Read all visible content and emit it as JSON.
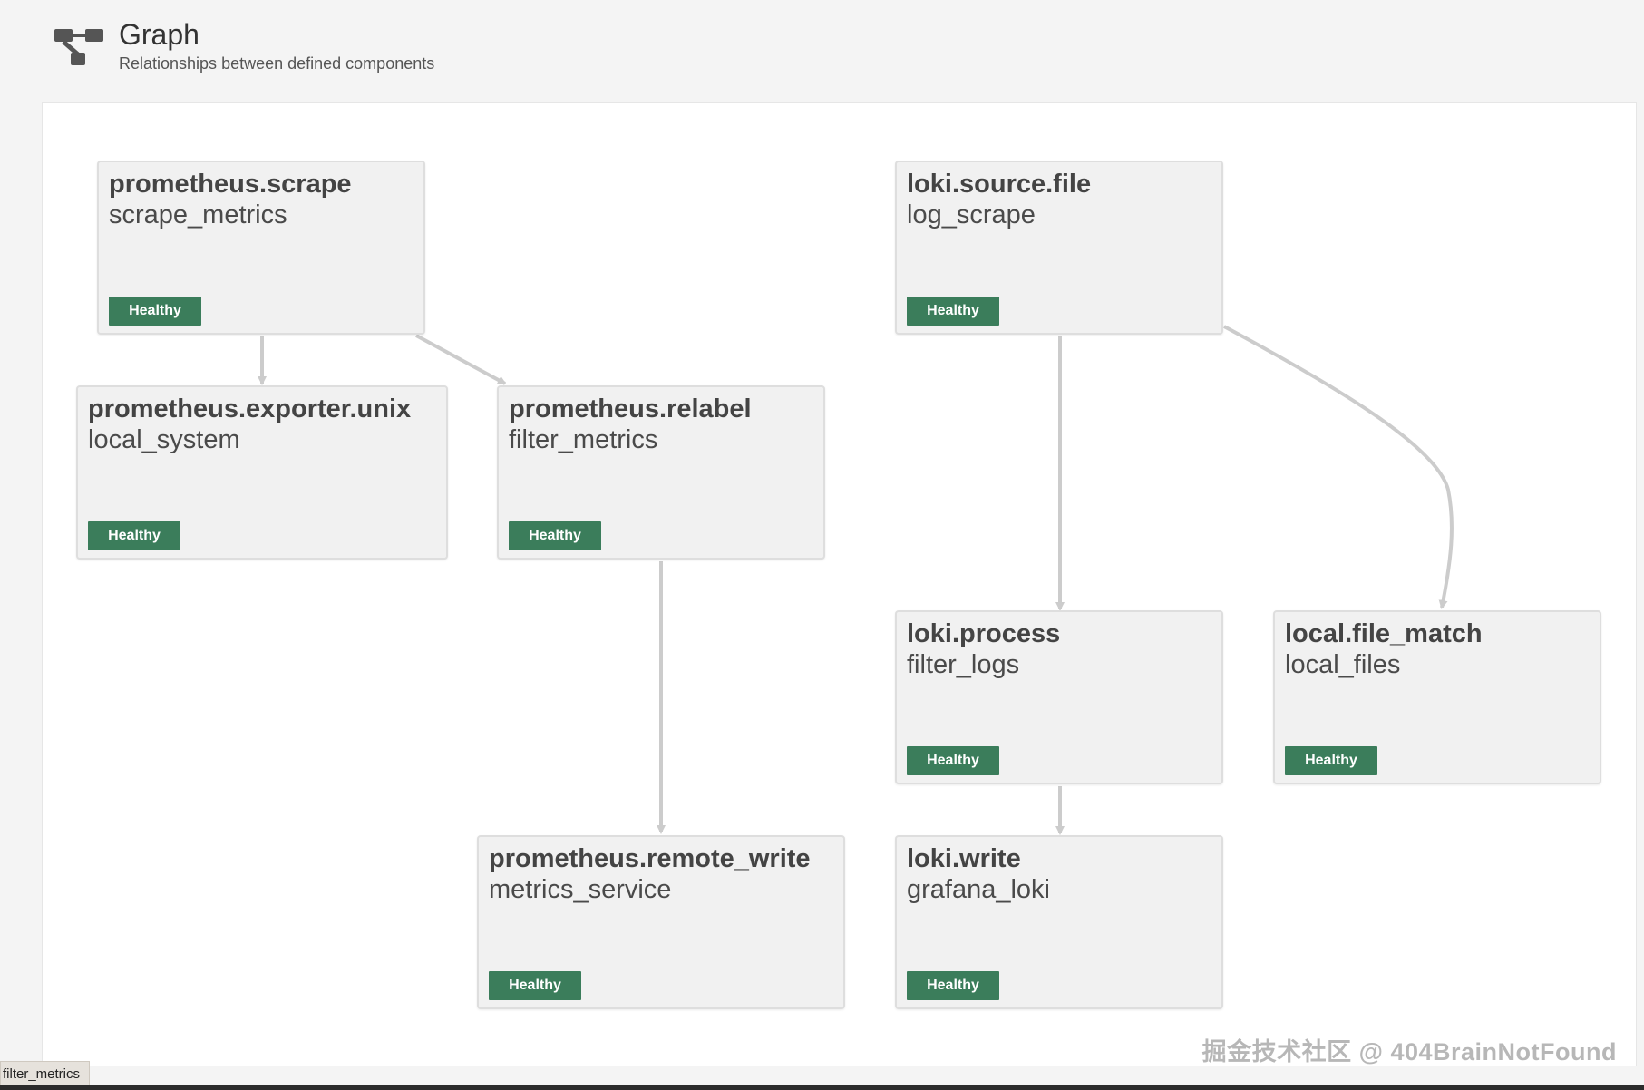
{
  "header": {
    "title": "Graph",
    "subtitle": "Relationships between defined components",
    "icon": "graph-icon"
  },
  "nodes": [
    {
      "type": "prometheus.scrape",
      "label": "scrape_metrics",
      "status": "Healthy"
    },
    {
      "type": "loki.source.file",
      "label": "log_scrape",
      "status": "Healthy"
    },
    {
      "type": "prometheus.exporter.unix",
      "label": "local_system",
      "status": "Healthy"
    },
    {
      "type": "prometheus.relabel",
      "label": "filter_metrics",
      "status": "Healthy"
    },
    {
      "type": "loki.process",
      "label": "filter_logs",
      "status": "Healthy"
    },
    {
      "type": "local.file_match",
      "label": "local_files",
      "status": "Healthy"
    },
    {
      "type": "prometheus.remote_write",
      "label": "metrics_service",
      "status": "Healthy"
    },
    {
      "type": "loki.write",
      "label": "grafana_loki",
      "status": "Healthy"
    }
  ],
  "status_tag": "filter_metrics",
  "watermark": "掘金技术社区 @ 404BrainNotFound",
  "colors": {
    "healthy": "#3b7d5b",
    "edge": "#cccccc",
    "node_bg": "#f1f1f1"
  }
}
